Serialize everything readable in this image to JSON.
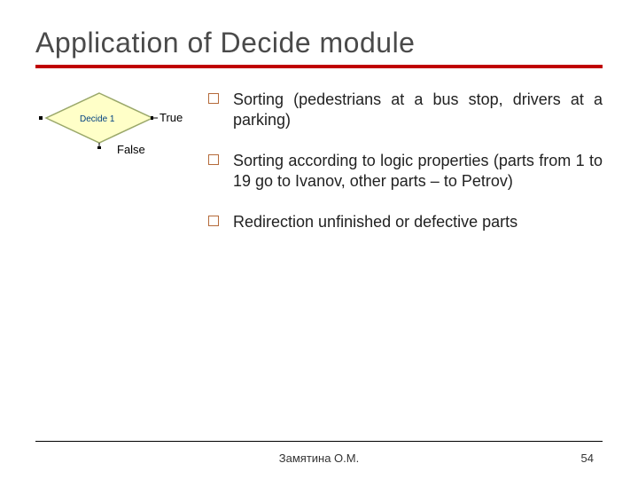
{
  "title": "Application of Decide module",
  "diagram": {
    "node_label": "Decide 1",
    "true_label": "True",
    "false_label": "False"
  },
  "bullets": [
    "Sorting (pedestrians at a bus stop, drivers at a parking)",
    "Sorting according to logic properties (parts from 1 to 19 go to Ivanov, other parts – to Petrov)",
    "Redirection unfinished or defective parts"
  ],
  "footer": {
    "author": "Замятина О.М.",
    "page": "54"
  }
}
